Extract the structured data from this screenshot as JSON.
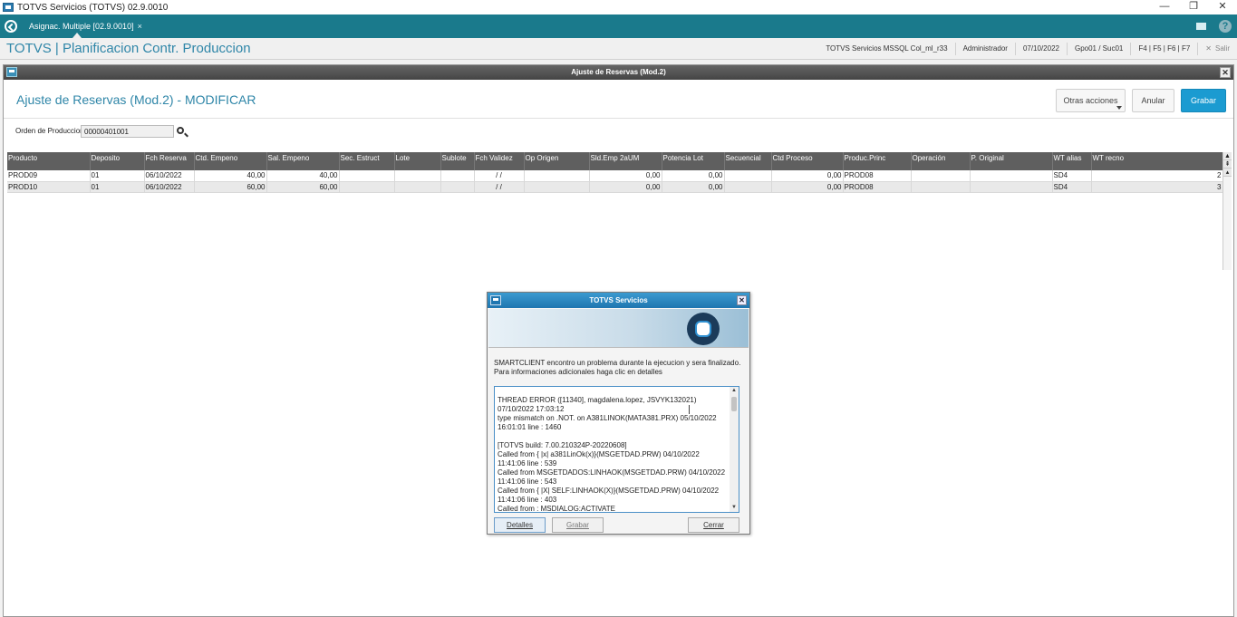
{
  "window": {
    "title": "TOTVS Servicios (TOTVS) 02.9.0010",
    "controls": [
      "—",
      "❐",
      "✕"
    ]
  },
  "tabbar": {
    "tab_label": "Asignac. Multiple [02.9.0010]",
    "tab_close": "×"
  },
  "header": {
    "title": "TOTVS | Planificacion Contr. Produccion",
    "info": [
      "TOTVS Servicios MSSQL Col_ml_r33",
      "Administrador",
      "07/10/2022",
      "Gpo01 / Suc01",
      "F4 | F5 | F6 | F7"
    ],
    "exit_label": "Salir"
  },
  "inner_window": {
    "title": "Ajuste de Reservas (Mod.2)",
    "page_title": "Ajuste de Reservas (Mod.2) - MODIFICAR",
    "buttons": {
      "otras": "Otras acciones",
      "anular": "Anular",
      "grabar": "Grabar"
    },
    "orden_label": "Orden de Produccion",
    "orden_value": "00000401001"
  },
  "grid": {
    "columns": [
      "Producto",
      "Deposito",
      "Fch Reserva",
      "Ctd. Empeno",
      "Sal. Empeno",
      "Sec. Estruct",
      "Lote",
      "Sublote",
      "Fch Validez",
      "Op Origen",
      "Sld.Emp 2aUM",
      "Potencia Lot",
      "Secuencial",
      "Ctd Proceso",
      "Produc.Princ",
      "Operación",
      "P. Original",
      "WT alias",
      "WT recno"
    ],
    "rows": [
      [
        "PROD09",
        "01",
        "06/10/2022",
        "40,00",
        "40,00",
        "",
        "",
        "",
        "/ /",
        "",
        "0,00",
        "0,00",
        "",
        "0,00",
        "PROD08",
        "",
        "",
        "SD4",
        "2"
      ],
      [
        "PROD10",
        "01",
        "06/10/2022",
        "60,00",
        "60,00",
        "",
        "",
        "",
        "/ /",
        "",
        "0,00",
        "0,00",
        "",
        "0,00",
        "PROD08",
        "",
        "",
        "SD4",
        "3"
      ]
    ]
  },
  "modal": {
    "title": "TOTVS Servicios",
    "message": "SMARTCLIENT encontro un problema durante la ejecucion y sera finalizado.\nPara informaciones adicionales haga clic en detalles",
    "log": "THREAD ERROR ([11340], magdalena.lopez, JSVYK132021)   07/10/2022 17:03:12\ntype mismatch on .NOT.  on A381LINOK(MATA381.PRX) 05/10/2022 16:01:01 line : 1460\n\n[TOTVS build: 7.00.210324P-20220608]\nCalled from { |x| a381LinOk(x)}(MSGETDAD.PRW) 04/10/2022 11:41:06 line : 539\nCalled from MSGETDADOS:LINHAOK(MSGETDAD.PRW) 04/10/2022 11:41:06 line : 543\nCalled from { |X| SELF:LINHAOK(X)}(MSGETDAD.PRW) 04/10/2022 11:41:06 line : 403\nCalled from : MSDIALOG:ACTIVATE",
    "buttons": {
      "detalles": "Detalles",
      "grabar": "Grabar",
      "cerrar": "Cerrar"
    }
  }
}
